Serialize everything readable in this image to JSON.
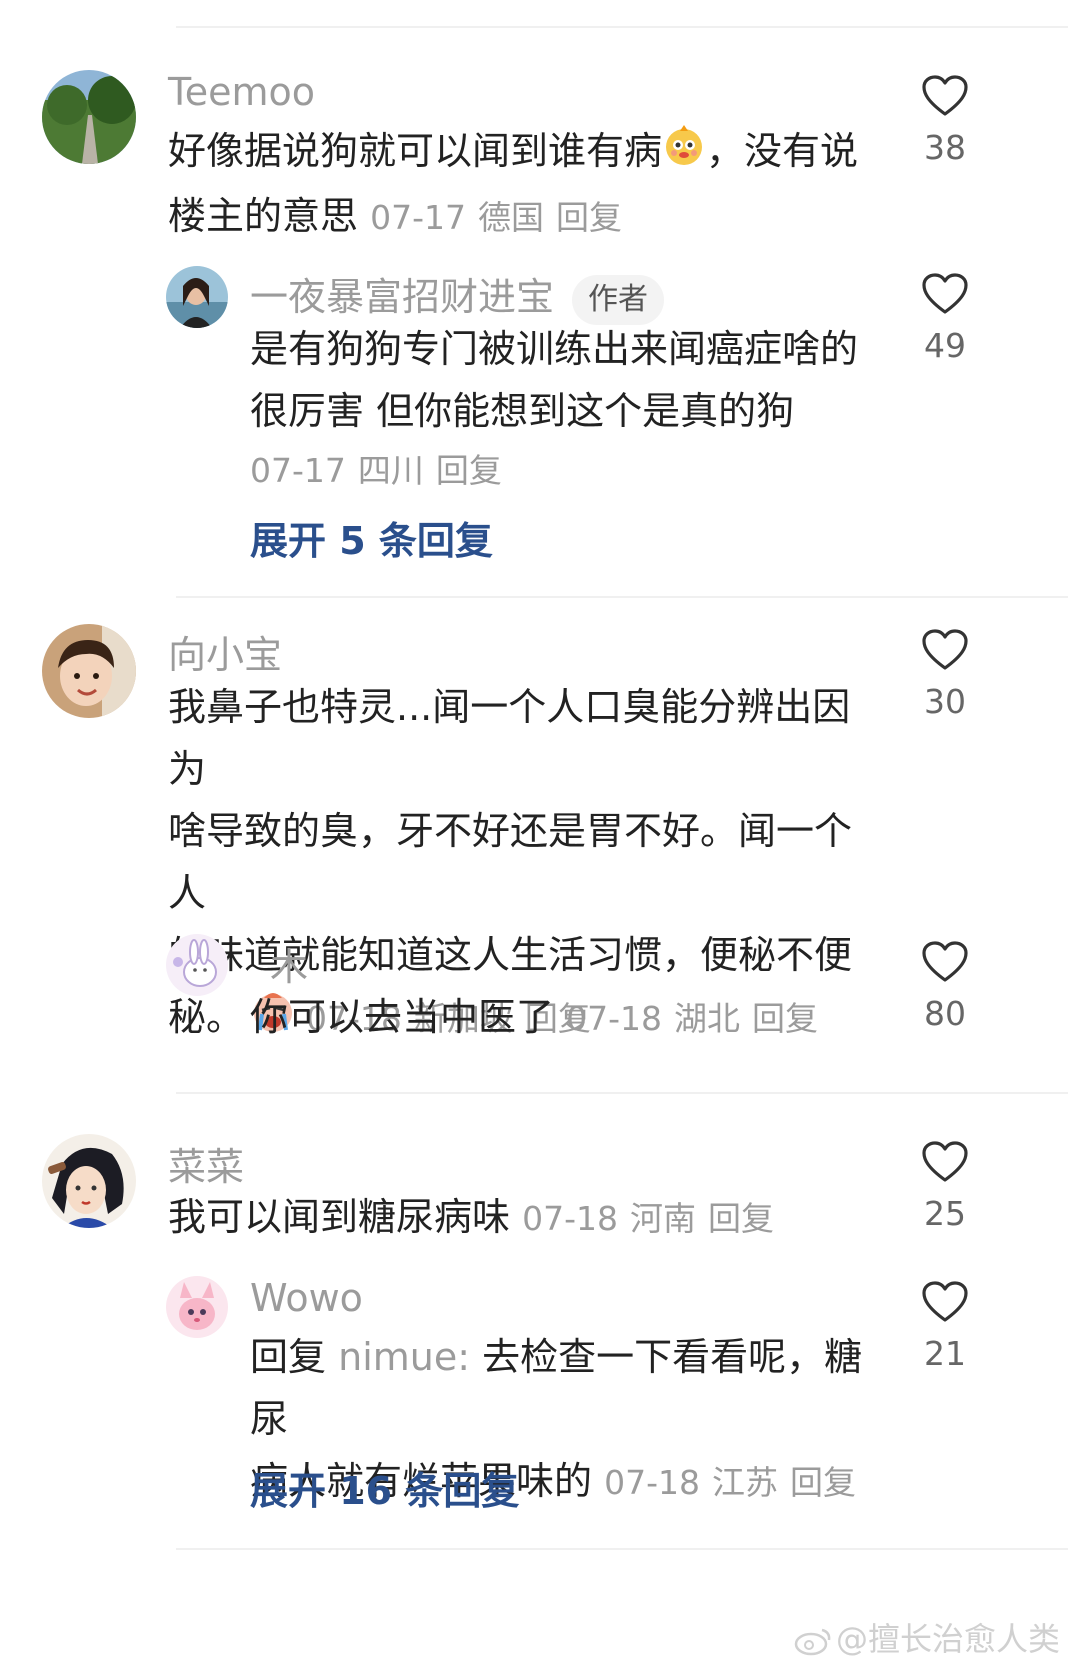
{
  "comments": [
    {
      "username": "Teemoo",
      "text_before_emoji": "好像据说狗就可以闻到谁有病",
      "text_after_emoji": "，没有说",
      "text_line2": "楼主的意思",
      "date": "07-17",
      "location": "德国",
      "reply_label": "回复",
      "likes": "38",
      "emoji_icon": "cartoon-face-emoji"
    },
    {
      "username": "一夜暴富招财进宝",
      "badge": "作者",
      "text_line1": "是有狗狗专门被训练出来闻癌症啥的",
      "text_line2": "很厉害 但你能想到这个是真的狗",
      "date": "07-17",
      "location": "四川",
      "reply_label": "回复",
      "likes": "49"
    },
    {
      "expand_label": "展开 5 条回复"
    },
    {
      "username": "向小宝",
      "text_line1": "我鼻子也特灵...闻一个人口臭能分辨出因为",
      "text_line2": "啥导致的臭，牙不好还是胃不好。闻一个人",
      "text_line3": "的味道就能知道这人生活习惯，便秘不便",
      "text_line4": "秘。",
      "date": "07-18",
      "location": "新加坡",
      "reply_label": "回复",
      "likes": "30",
      "emoji_icon": "crying-face-emoji"
    },
    {
      "username": "木",
      "text": "你可以去当中医了",
      "date": "07-18",
      "location": "湖北",
      "reply_label": "回复",
      "likes": "80"
    },
    {
      "username": "菜菜",
      "text": "我可以闻到糖尿病味",
      "date": "07-18",
      "location": "河南",
      "reply_label": "回复",
      "likes": "25"
    },
    {
      "username": "Wowo",
      "reply_prefix": "回复",
      "reply_to": "nimue:",
      "text_line1": "去检查一下看看呢，糖尿",
      "text_line2": "病人就有烂苹果味的",
      "date": "07-18",
      "location": "江苏",
      "reply_label": "回复",
      "likes": "21"
    },
    {
      "expand_label": "展开 16 条回复"
    }
  ],
  "watermark": "@擅长治愈人类",
  "colors": {
    "username": "#9b9b9b",
    "link": "#2a4f8c",
    "divider": "#f0f0f0"
  }
}
